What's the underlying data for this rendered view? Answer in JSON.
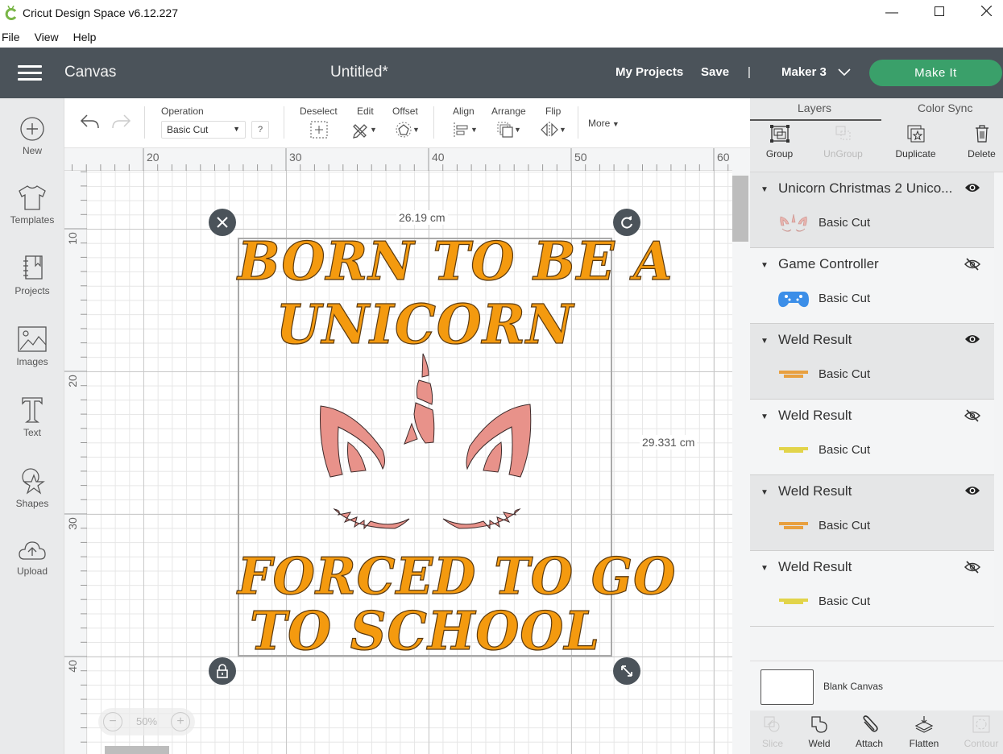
{
  "window": {
    "title": "Cricut Design Space  v6.12.227",
    "controls": [
      "minimize-icon",
      "maximize-icon",
      "close-icon"
    ]
  },
  "menubar": {
    "items": [
      "File",
      "View",
      "Help"
    ]
  },
  "header": {
    "section": "Canvas",
    "document_title": "Untitled*",
    "my_projects": "My Projects",
    "save": "Save",
    "divider": "|",
    "machine": "Maker 3",
    "make_it": "Make It",
    "make_it_color": "#3aa06a",
    "header_color": "#4b535a"
  },
  "leftbar": {
    "items": [
      {
        "label": "New",
        "icon": "plus-circle-icon"
      },
      {
        "label": "Templates",
        "icon": "tshirt-icon"
      },
      {
        "label": "Projects",
        "icon": "notebook-icon"
      },
      {
        "label": "Images",
        "icon": "image-icon"
      },
      {
        "label": "Text",
        "icon": "text-t-icon"
      },
      {
        "label": "Shapes",
        "icon": "shapes-icon"
      },
      {
        "label": "Upload",
        "icon": "cloud-upload-icon"
      }
    ]
  },
  "toolbar": {
    "operation_label": "Operation",
    "operation_value": "Basic Cut",
    "help": "?",
    "deselect": "Deselect",
    "edit": "Edit",
    "offset": "Offset",
    "align": "Align",
    "arrange": "Arrange",
    "flip": "Flip",
    "more": "More"
  },
  "canvas": {
    "ruler_top": [
      "20",
      "30",
      "40",
      "50",
      "60"
    ],
    "ruler_left": [
      "10",
      "20",
      "30",
      "40"
    ],
    "width_label": "26.19 cm",
    "height_label": "29.331 cm",
    "zoom_level": "50%",
    "zoom_minus": "−",
    "zoom_plus": "+",
    "design": {
      "line1": "BORN TO BE A",
      "line2": "UNICORN",
      "line3": "FORCED TO GO",
      "line4": "TO  SCHOOL",
      "text_color": "#f49a0f",
      "art_color": "#e8928a"
    }
  },
  "panel": {
    "tabs": [
      "Layers",
      "Color Sync"
    ],
    "actions": [
      {
        "label": "Group",
        "enabled": true
      },
      {
        "label": "UnGroup",
        "enabled": false
      },
      {
        "label": "Duplicate",
        "enabled": true
      },
      {
        "label": "Delete",
        "enabled": true
      }
    ],
    "layers": [
      {
        "name": "Unicorn Christmas 2 Unico...",
        "operation": "Basic Cut",
        "visible": true,
        "thumb": "unicorn-face"
      },
      {
        "name": "Game Controller",
        "operation": "Basic Cut",
        "visible": false,
        "thumb": "game-controller"
      },
      {
        "name": "Weld Result",
        "operation": "Basic Cut",
        "visible": true,
        "thumb": "text-orange"
      },
      {
        "name": "Weld Result",
        "operation": "Basic Cut",
        "visible": false,
        "thumb": "text-yellow"
      },
      {
        "name": "Weld Result",
        "operation": "Basic Cut",
        "visible": true,
        "thumb": "text-orange"
      },
      {
        "name": "Weld Result",
        "operation": "Basic Cut",
        "visible": false,
        "thumb": "text-yellow"
      }
    ],
    "blank_canvas": "Blank Canvas",
    "bottom_actions": [
      {
        "label": "Slice",
        "enabled": false
      },
      {
        "label": "Weld",
        "enabled": true
      },
      {
        "label": "Attach",
        "enabled": true
      },
      {
        "label": "Flatten",
        "enabled": true
      },
      {
        "label": "Contour",
        "enabled": false
      }
    ]
  }
}
